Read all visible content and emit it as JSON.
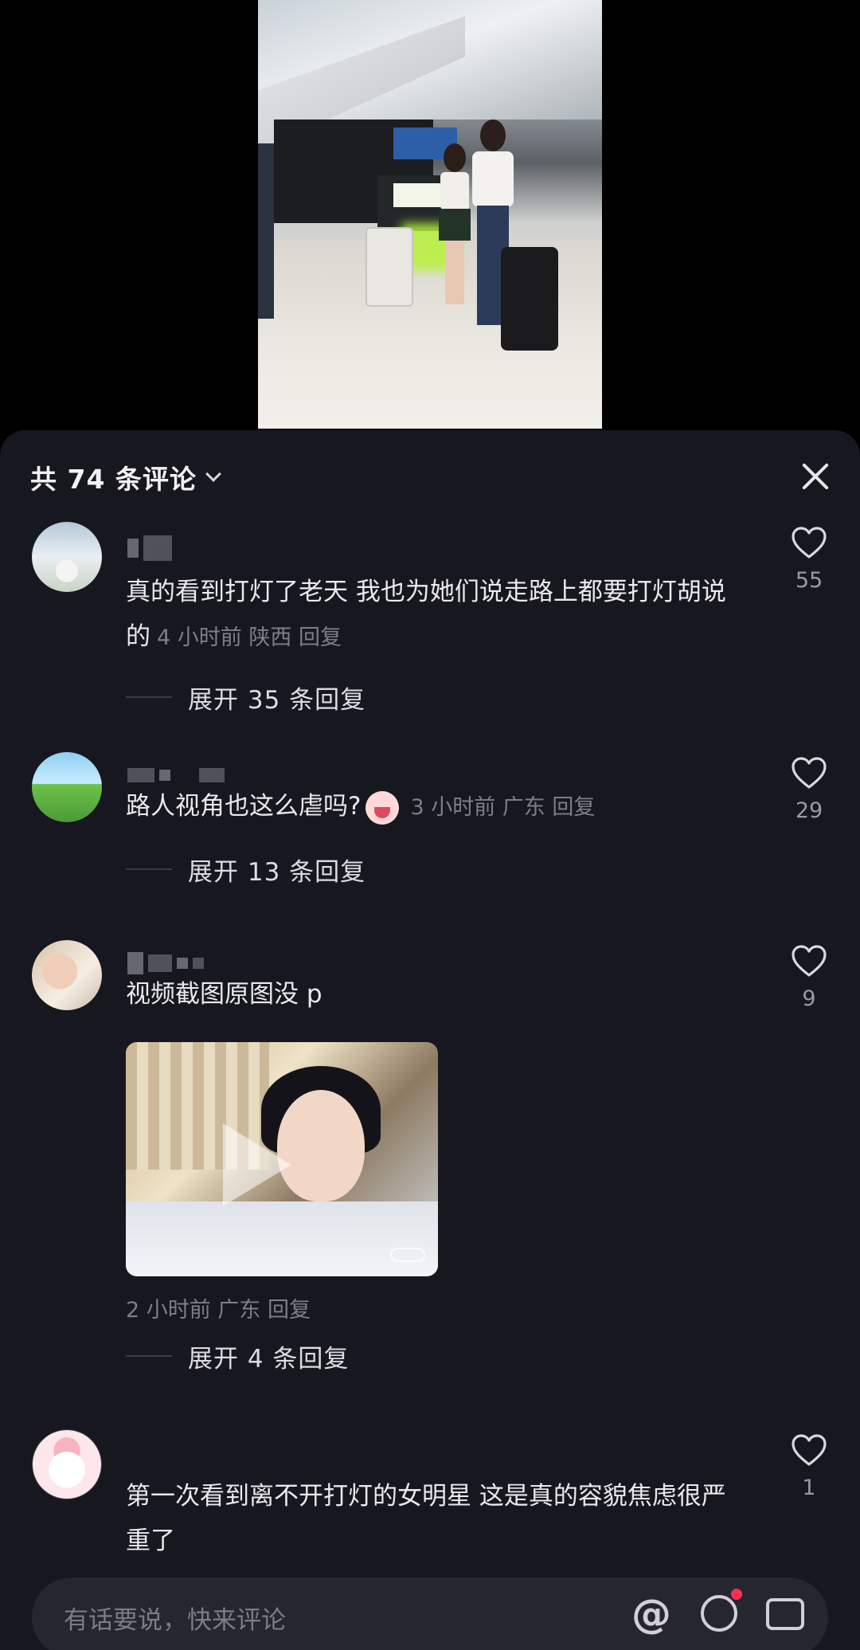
{
  "header": {
    "title": "共 74 条评论",
    "close_icon": "close-icon"
  },
  "comments": [
    {
      "text": "真的看到打灯了老天 我也为她们说走路上都要打灯胡说的",
      "time": "4 小时前",
      "location": "陕西",
      "reply": "回复",
      "expand": "展开 35 条回复",
      "likes": "55"
    },
    {
      "text": "路人视角也这么虐吗?",
      "emoji": "crying-laughing-emoji",
      "time": "3 小时前",
      "location": "广东",
      "reply": "回复",
      "expand": "展开 13 条回复",
      "likes": "29"
    },
    {
      "text": "视频截图原图没 p",
      "time": "2 小时前",
      "location": "广东",
      "reply": "回复",
      "expand": "展开 4 条回复",
      "likes": "9",
      "media": "video-thumbnail"
    },
    {
      "text": "第一次看到离不开打灯的女明星 这是真的容貌焦虑很严重了",
      "likes": "1"
    }
  ],
  "input": {
    "placeholder": "有话要说，快来评论",
    "at_symbol": "@"
  },
  "colors": {
    "panel_bg": "#17171f",
    "text": "#e9e9ee",
    "meta": "#7e7e88",
    "badge": "#ff2d55"
  }
}
